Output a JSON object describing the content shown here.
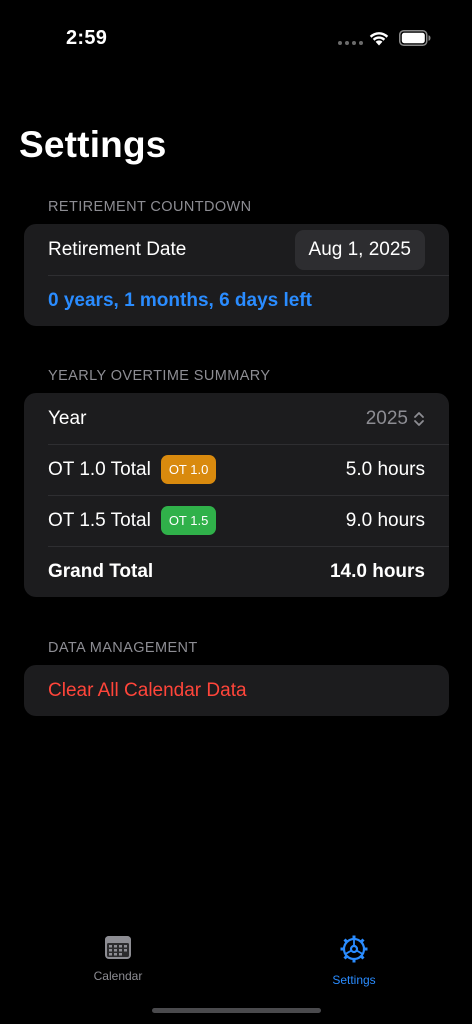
{
  "status_bar": {
    "time": "2:59"
  },
  "page": {
    "title": "Settings"
  },
  "retirement": {
    "header": "RETIREMENT COUNTDOWN",
    "date_label": "Retirement Date",
    "date_value": "Aug 1, 2025",
    "countdown": "0 years, 1 months, 6 days left"
  },
  "overtime": {
    "header": "YEARLY OVERTIME SUMMARY",
    "year_label": "Year",
    "year_value": "2025",
    "rows": [
      {
        "label": "OT 1.0 Total",
        "badge": "OT 1.0",
        "badge_color": "#d98a0e",
        "value": "5.0 hours"
      },
      {
        "label": "OT 1.5 Total",
        "badge": "OT 1.5",
        "badge_color": "#30b14a",
        "value": "9.0 hours"
      }
    ],
    "grand_total_label": "Grand Total",
    "grand_total_value": "14.0 hours"
  },
  "data_management": {
    "header": "DATA MANAGEMENT",
    "clear_label": "Clear All Calendar Data"
  },
  "tab_bar": {
    "calendar_label": "Calendar",
    "settings_label": "Settings",
    "active": "Settings"
  },
  "colors": {
    "accent": "#2a8cff",
    "danger": "#ff453a",
    "card": "#1c1c1e",
    "background": "#000000"
  }
}
